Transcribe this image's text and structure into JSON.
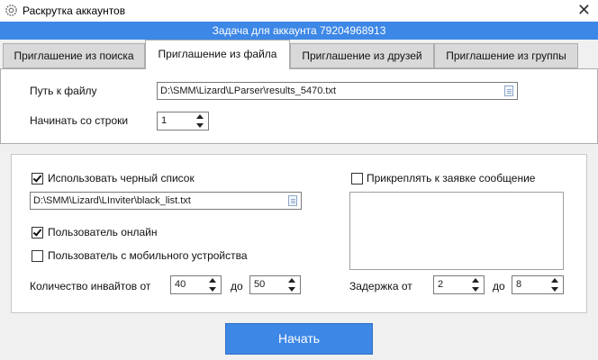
{
  "window": {
    "title": "Раскрутка аккаунтов",
    "close_glyph": "✕"
  },
  "task_header": "Задача для аккаунта 79204968913",
  "tabs": [
    {
      "label": "Приглашение из поиска",
      "active": false
    },
    {
      "label": "Приглашение из файла",
      "active": true
    },
    {
      "label": "Приглашение из друзей",
      "active": false
    },
    {
      "label": "Приглашение из группы",
      "active": false
    }
  ],
  "file_tab": {
    "path_label": "Путь к файлу",
    "path_value": "D:\\SMM\\Lizard\\LParser\\results_5470.txt",
    "start_row_label": "Начинать со строки",
    "start_row_value": "1"
  },
  "options": {
    "blacklist_label": "Использовать черный список",
    "blacklist_checked": true,
    "blacklist_path": "D:\\SMM\\Lizard\\LInviter\\black_list.txt",
    "online_label": "Пользователь онлайн",
    "online_checked": true,
    "mobile_label": "Пользователь с мобильного устройства",
    "mobile_checked": false,
    "attach_message_label": "Прикреплять к заявке сообщение",
    "attach_message_checked": false,
    "attach_message_text": "",
    "invites_label": "Количество инвайтов от",
    "invites_from": "40",
    "to_label": "до",
    "invites_to": "50",
    "delay_label": "Задержка от",
    "delay_from": "2",
    "delay_to_label": "до",
    "delay_to": "8"
  },
  "start_button": "Начать",
  "colors": {
    "accent": "#3d87e6",
    "window_bg": "#f0f0f0"
  },
  "icons": {
    "app": "gear-icon",
    "close": "close-icon",
    "file_picker": "file-icon"
  }
}
